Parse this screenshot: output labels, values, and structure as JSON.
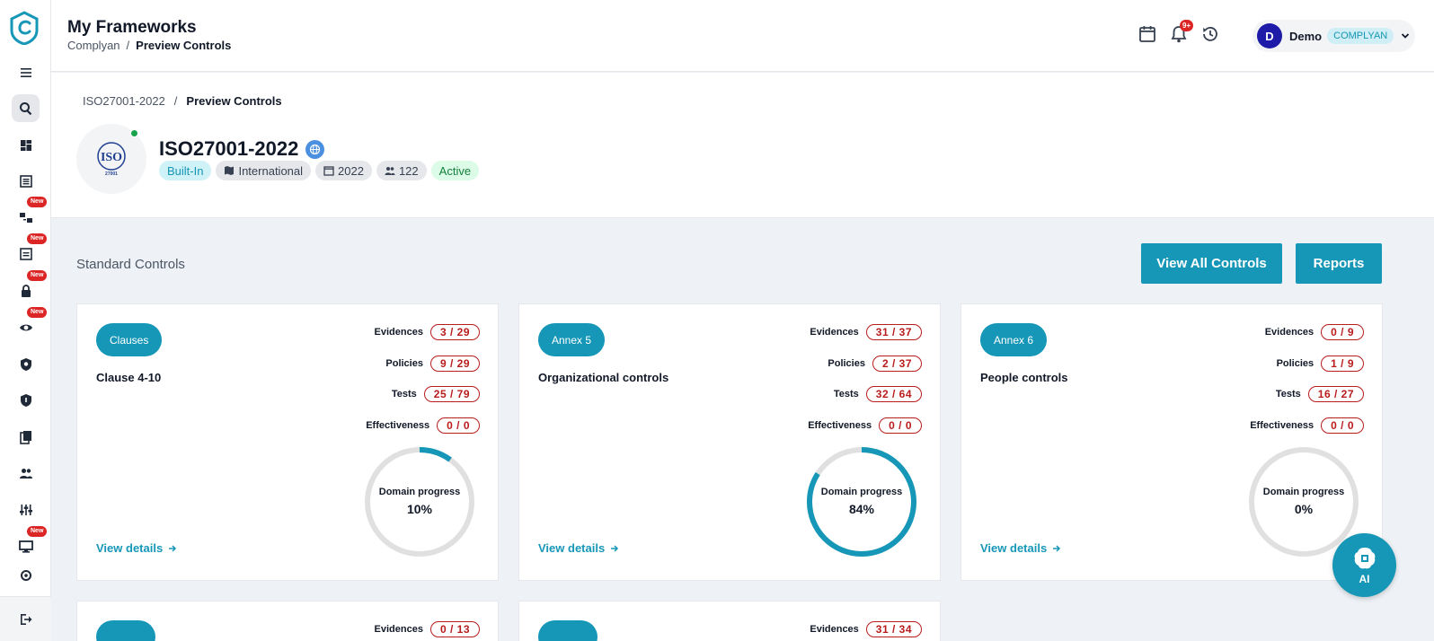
{
  "header": {
    "title": "My Frameworks",
    "breadcrumb": [
      "Complyan",
      "Preview Controls"
    ],
    "notification_count": "9+",
    "user": {
      "initial": "D",
      "name": "Demo",
      "org": "COMPLYAN"
    }
  },
  "framework": {
    "breadcrumb": [
      "ISO27001-2022",
      "Preview Controls"
    ],
    "name": "ISO27001-2022",
    "logo_text": "ISO",
    "logo_subtext": "27001",
    "tags": {
      "builtin": "Built-In",
      "region": "International",
      "year": "2022",
      "members": "122",
      "status": "Active"
    }
  },
  "controls": {
    "section_title": "Standard Controls",
    "view_all_label": "View All Controls",
    "reports_label": "Reports",
    "stat_labels": {
      "evidences": "Evidences",
      "policies": "Policies",
      "tests": "Tests",
      "effectiveness": "Effectiveness"
    },
    "progress_label": "Domain progress",
    "view_details_label": "View details",
    "cards": [
      {
        "chip": "Clauses",
        "title": "Clause 4-10",
        "evidences": "3 / 29",
        "policies": "9 / 29",
        "tests": "25 / 79",
        "effectiveness": "0 / 0",
        "progress": 10,
        "progress_text": "10%"
      },
      {
        "chip": "Annex 5",
        "title": "Organizational controls",
        "evidences": "31 / 37",
        "policies": "2 / 37",
        "tests": "32 / 64",
        "effectiveness": "0 / 0",
        "progress": 84,
        "progress_text": "84%"
      },
      {
        "chip": "Annex 6",
        "title": "People controls",
        "evidences": "0 / 9",
        "policies": "1 / 9",
        "tests": "16 / 27",
        "effectiveness": "0 / 0",
        "progress": 0,
        "progress_text": "0%"
      },
      {
        "evidences": "0 / 13"
      },
      {
        "evidences": "31 / 34"
      }
    ]
  },
  "sidebar": {
    "new_badge": "New",
    "items": [
      {
        "icon": "menu-icon"
      },
      {
        "icon": "search-icon",
        "active": true
      },
      {
        "icon": "dashboard-icon"
      },
      {
        "icon": "list-icon"
      },
      {
        "icon": "hierarchy-icon",
        "new": true
      },
      {
        "icon": "document-list-icon",
        "new": true
      },
      {
        "icon": "lock-icon",
        "new": true
      },
      {
        "icon": "eye-icon",
        "new": true
      },
      {
        "icon": "shield-search-icon"
      },
      {
        "icon": "shield-icon"
      },
      {
        "icon": "documents-icon"
      },
      {
        "icon": "users-icon"
      },
      {
        "icon": "sliders-icon"
      },
      {
        "icon": "monitor-icon",
        "new": true
      },
      {
        "icon": "logout-icon"
      }
    ]
  },
  "ai_button_label": "AI",
  "colors": {
    "accent": "#1697b7",
    "danger": "#b91c1c",
    "track": "#e0e0e0"
  }
}
